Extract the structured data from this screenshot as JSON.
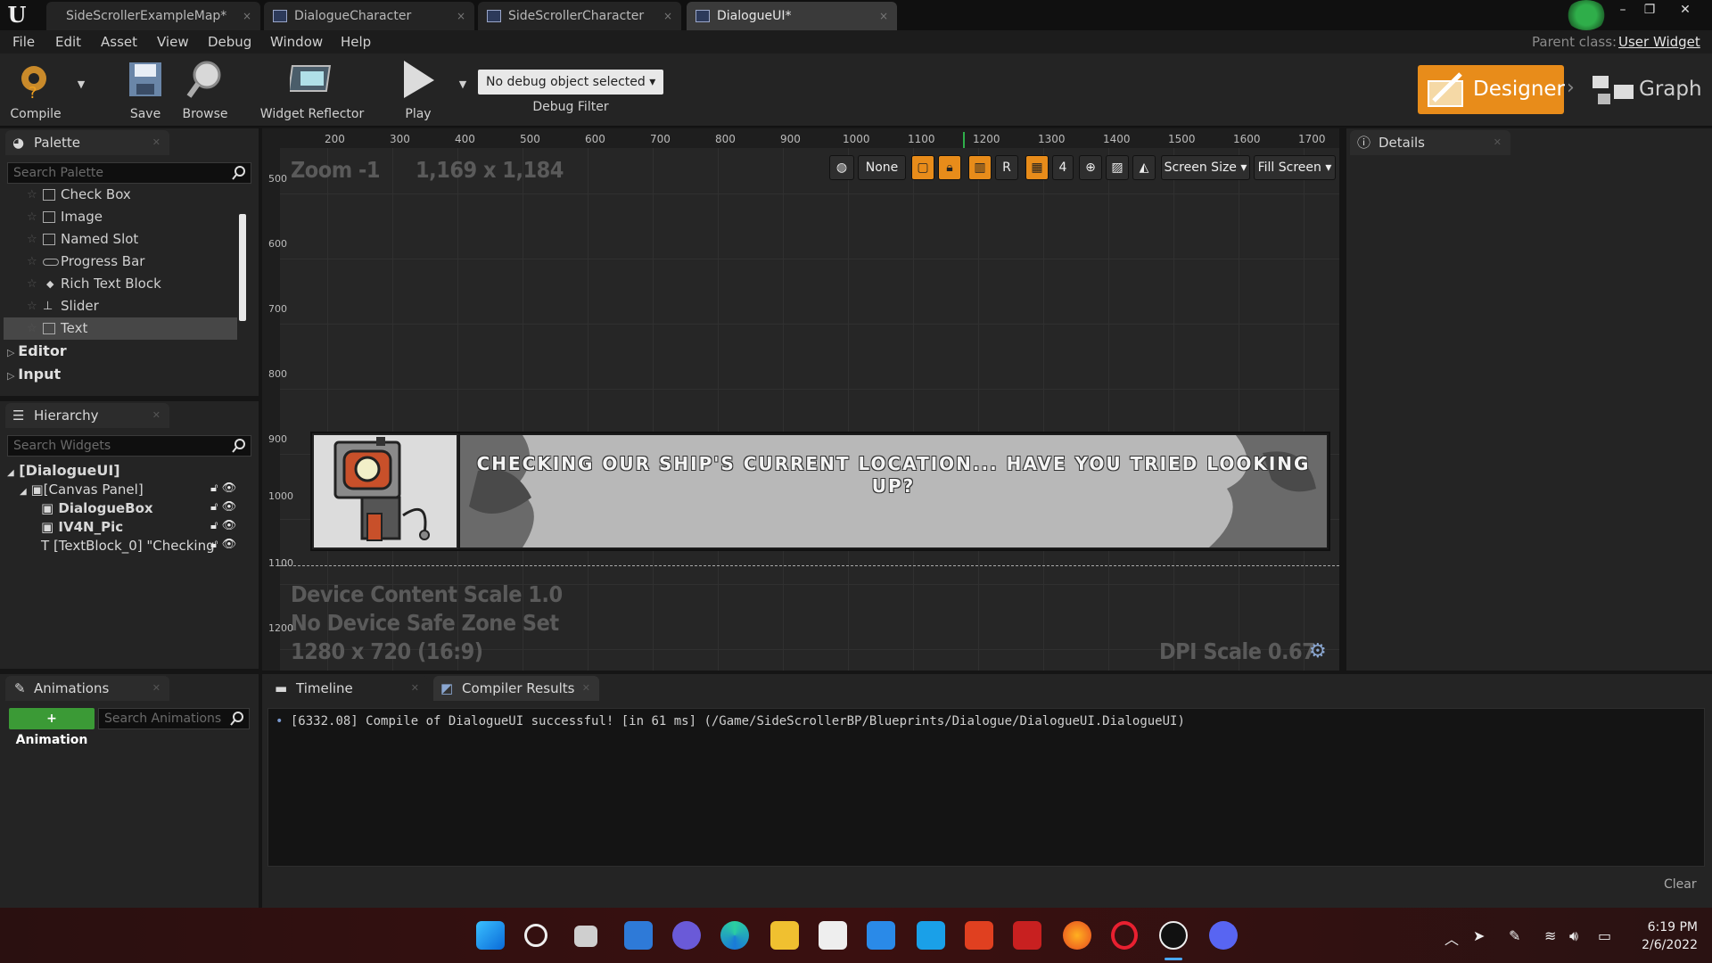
{
  "titlebar": {
    "tabs": [
      {
        "label": "SideScrollerExampleMap*"
      },
      {
        "label": "DialogueCharacter"
      },
      {
        "label": "SideScrollerCharacter"
      },
      {
        "label": "DialogueUI*"
      }
    ],
    "active_tab": "DialogueUI*",
    "parent_class_label": "Parent class:",
    "parent_class_value": "User Widget"
  },
  "menubar": {
    "items": [
      "File",
      "Edit",
      "Asset",
      "View",
      "Debug",
      "Window",
      "Help"
    ]
  },
  "toolbar": {
    "compile": "Compile",
    "save": "Save",
    "browse": "Browse",
    "widget_reflector": "Widget Reflector",
    "play": "Play",
    "debug_select": "No debug object selected",
    "debug_filter": "Debug Filter",
    "designer": "Designer",
    "graph": "Graph"
  },
  "palette": {
    "tab": "Palette",
    "search_placeholder": "Search Palette",
    "items": [
      "Check Box",
      "Image",
      "Named Slot",
      "Progress Bar",
      "Rich Text Block",
      "Slider",
      "Text"
    ],
    "selected": "Text",
    "categories": [
      "Editor",
      "Input"
    ]
  },
  "hierarchy": {
    "tab": "Hierarchy",
    "search_placeholder": "Search Widgets",
    "root": "[DialogueUI]",
    "canvas": "[Canvas Panel]",
    "children": [
      "DialogueBox",
      "IV4N_Pic",
      "[TextBlock_0] \"Checking"
    ]
  },
  "details": {
    "tab": "Details"
  },
  "designer_view": {
    "ruler_ticks": [
      "200",
      "300",
      "400",
      "500",
      "600",
      "700",
      "800",
      "900",
      "1000",
      "1100",
      "1200",
      "1300",
      "1400",
      "1500",
      "1600",
      "1700"
    ],
    "left_ruler": [
      "500",
      "600",
      "700",
      "800",
      "900",
      "1000",
      "1100",
      "1200"
    ],
    "zoom": "Zoom -1",
    "size": "1,169 x 1,184",
    "toolbar": {
      "none": "None",
      "r": "R",
      "grid_value": "4",
      "screen_size": "Screen Size",
      "fill_screen": "Fill Screen"
    },
    "dialogue_text": "CHECKING OUR SHIP'S CURRENT LOCATION... HAVE YOU TRIED LOOKING UP?",
    "device_content_scale": "Device Content Scale 1.0",
    "safe_zone": "No Device Safe Zone Set",
    "resolution": "1280 x 720 (16:9)",
    "dpi_scale": "DPI Scale 0.67"
  },
  "animations": {
    "tab": "Animations",
    "add_button": "+ Animation",
    "search_placeholder": "Search Animations"
  },
  "bottom_tabs": {
    "timeline": "Timeline",
    "compiler_results": "Compiler Results",
    "log_line": "[6332.08] Compile of DialogueUI successful! [in 61 ms] (/Game/SideScrollerBP/Blueprints/Dialogue/DialogueUI.DialogueUI)",
    "clear": "Clear"
  },
  "taskbar": {
    "time": "6:19 PM",
    "date": "2/6/2022"
  },
  "colors": {
    "accent": "#e88c1a",
    "bg": "#242424"
  }
}
